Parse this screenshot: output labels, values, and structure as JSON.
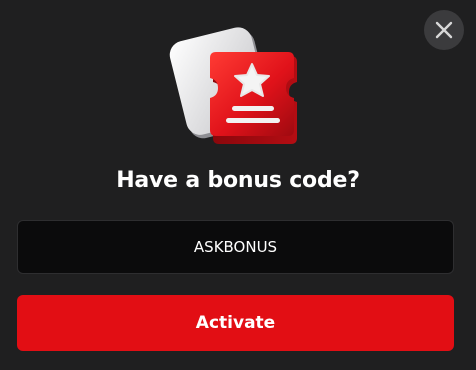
{
  "dialog": {
    "title": "Have a bonus code?",
    "code_input": {
      "value": "ASKBONUS",
      "placeholder": ""
    },
    "activate_label": "Activate",
    "close_icon": "close-icon",
    "hero_icon": "bonus-ticket-star-icon"
  },
  "colors": {
    "background": "#1f1f20",
    "accent": "#e20e14",
    "input_background": "#0b0b0c",
    "close_button": "#3b3b3d"
  }
}
